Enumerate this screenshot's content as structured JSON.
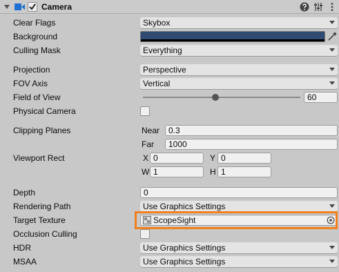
{
  "header": {
    "title": "Camera",
    "enabled": true,
    "icons": [
      "fold-arrow-icon",
      "camera-icon",
      "help-icon",
      "presets-icon",
      "more-menu-icon"
    ]
  },
  "props": {
    "clear_flags": {
      "label": "Clear Flags",
      "value": "Skybox"
    },
    "background": {
      "label": "Background",
      "color": "#304a72"
    },
    "culling_mask": {
      "label": "Culling Mask",
      "value": "Everything"
    },
    "projection": {
      "label": "Projection",
      "value": "Perspective"
    },
    "fov_axis": {
      "label": "FOV Axis",
      "value": "Vertical"
    },
    "field_of_view": {
      "label": "Field of View",
      "value": "60",
      "slider_fraction": 0.46
    },
    "physical_camera": {
      "label": "Physical Camera",
      "checked": false
    },
    "clipping_planes": {
      "label": "Clipping Planes",
      "near_label": "Near",
      "near": "0.3",
      "far_label": "Far",
      "far": "1000"
    },
    "viewport_rect": {
      "label": "Viewport Rect",
      "x_label": "X",
      "x": "0",
      "y_label": "Y",
      "y": "0",
      "w_label": "W",
      "w": "1",
      "h_label": "H",
      "h": "1"
    },
    "depth": {
      "label": "Depth",
      "value": "0"
    },
    "rendering_path": {
      "label": "Rendering Path",
      "value": "Use Graphics Settings"
    },
    "target_texture": {
      "label": "Target Texture",
      "value": "ScopeSight"
    },
    "occlusion_culling": {
      "label": "Occlusion Culling",
      "checked": false
    },
    "hdr": {
      "label": "HDR",
      "value": "Use Graphics Settings"
    },
    "msaa": {
      "label": "MSAA",
      "value": "Use Graphics Settings"
    }
  },
  "colors": {
    "highlight": "#f27f1b",
    "panel": "#c8c8c8"
  }
}
